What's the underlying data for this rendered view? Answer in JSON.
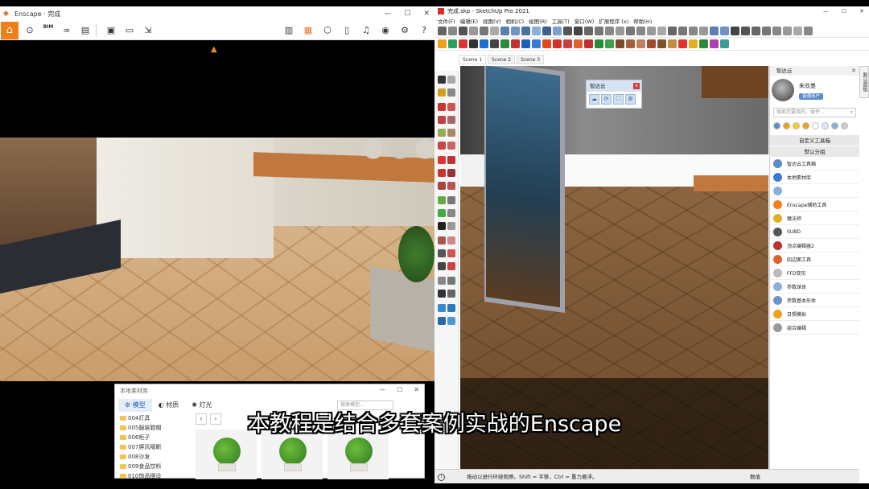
{
  "enscape": {
    "title": "Enscape · 完成",
    "window_controls": [
      "—",
      "☐",
      "✕"
    ],
    "toolbar": {
      "home": "⌂",
      "bim_label": "BIM",
      "left_icons": [
        "location",
        "bim",
        "binoculars",
        "clapper",
        "screenshot",
        "batch-render",
        "export"
      ],
      "right_icons": [
        "map",
        "orange-cube",
        "cube",
        "books",
        "sound",
        "eye",
        "gear",
        "help"
      ]
    }
  },
  "library": {
    "title": "本地素材库",
    "window_controls": [
      "—",
      "☐",
      "✕"
    ],
    "tabs": [
      {
        "label": "模型",
        "active": true
      },
      {
        "label": "材质",
        "active": false
      },
      {
        "label": "灯光",
        "active": false
      }
    ],
    "search_placeholder": "搜索模型...",
    "categories": [
      "004灯具",
      "005服装鞋帽",
      "006柜子",
      "007屏风隔断",
      "008沙发",
      "009食品饮料",
      "010饰品摆设"
    ]
  },
  "sketchup": {
    "title": "完成.skp - SketchUp Pro 2021",
    "window_controls": [
      "—",
      "☐",
      "✕"
    ],
    "menu": [
      "文件(F)",
      "编辑(E)",
      "视图(V)",
      "相机(C)",
      "绘图(R)",
      "工具(T)",
      "窗口(W)",
      "扩展程序 (x)",
      "帮助(H)"
    ],
    "scenes": [
      {
        "label": "Scene 1",
        "active": true
      },
      {
        "label": "Scene 2",
        "active": false
      },
      {
        "label": "Scene 3",
        "active": false
      }
    ],
    "floating_toolbar": {
      "title": "智达云",
      "close": "x"
    },
    "status": {
      "hint": "拖动以进行环绕观察。Shift = 平移，Ctrl = 重力悬浮。",
      "value_label": "数值"
    },
    "side_tab": "默认面板"
  },
  "panel": {
    "title": "智达云",
    "controls": "✕",
    "user": {
      "name": "朱欢墨",
      "badge": "普通用户"
    },
    "search_placeholder": "搜索您要找的，插件...",
    "section_custom": "自定义工具箱",
    "section_default": "默认分组",
    "items_top": [
      "智达云工具箱",
      "本地素材库"
    ],
    "items": [
      "Enscape辅助工具",
      "魔法师",
      "SUBD",
      "顶点编辑器2",
      "四边面工具",
      "FFD变形",
      "参数球体",
      "参数基本形体",
      "日照模拟",
      "组合编辑"
    ],
    "colors": {
      "accent": "#5a8dc9",
      "orange": "#f07f1a"
    }
  },
  "subtitle": "本教程是结合多套案例实战的Enscape"
}
